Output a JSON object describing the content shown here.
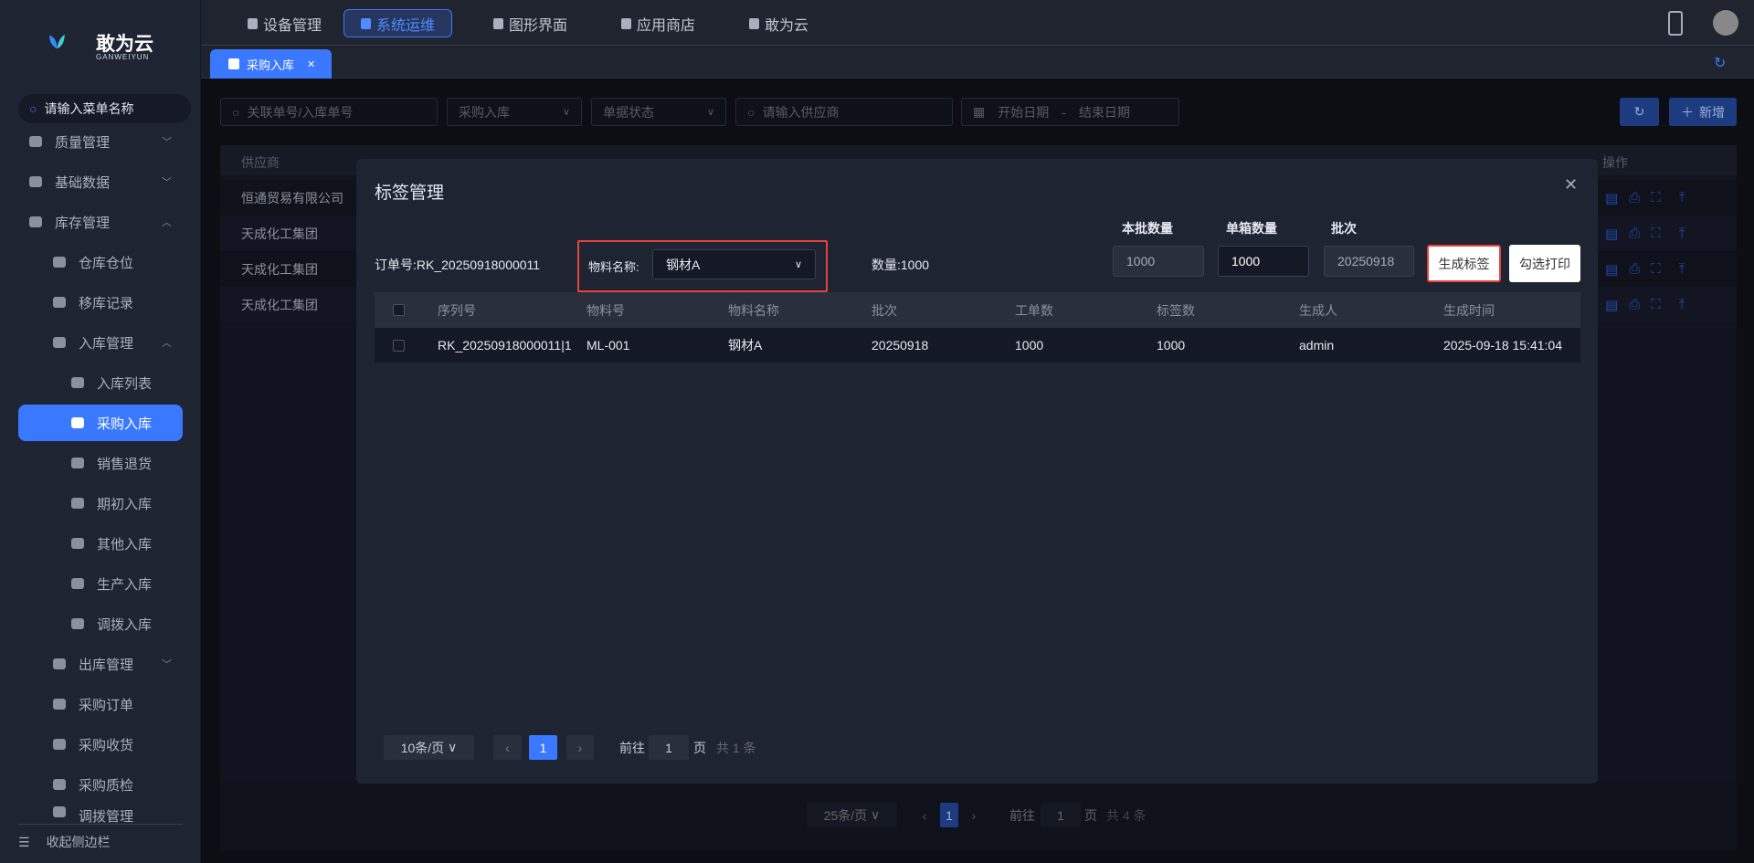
{
  "brand": {
    "name": "敢为云",
    "sub": "GANWEIYUN"
  },
  "sidebar": {
    "search_placeholder": "请输入菜单名称",
    "items": [
      {
        "label": "质量管理",
        "chev": "﹀"
      },
      {
        "label": "基础数据",
        "chev": "﹀"
      },
      {
        "label": "库存管理",
        "chev": "︿"
      },
      {
        "label": "仓库仓位"
      },
      {
        "label": "移库记录"
      },
      {
        "label": "入库管理",
        "chev": "︿"
      },
      {
        "label": "入库列表"
      },
      {
        "label": "采购入库"
      },
      {
        "label": "销售退货"
      },
      {
        "label": "期初入库"
      },
      {
        "label": "其他入库"
      },
      {
        "label": "生产入库"
      },
      {
        "label": "调拨入库"
      },
      {
        "label": "出库管理",
        "chev": "﹀"
      },
      {
        "label": "采购订单"
      },
      {
        "label": "采购收货"
      },
      {
        "label": "采购质检"
      },
      {
        "label": "调拨管理"
      }
    ],
    "collapse": "收起侧边栏"
  },
  "topnav": [
    "设备管理",
    "系统运维",
    "图形界面",
    "应用商店",
    "敢为云"
  ],
  "tab": {
    "label": "采购入库",
    "close": "✕"
  },
  "filters": {
    "search": "关联单号/入库单号",
    "type": "采购入库",
    "status": "单据状态",
    "supplier": "请输入供应商",
    "start": "开始日期",
    "sep": "-",
    "end": "结束日期",
    "add": "新增"
  },
  "table": {
    "headers": {
      "supplier": "供应商",
      "ops": "操作"
    },
    "rows": [
      "恒通贸易有限公司",
      "天成化工集团",
      "天成化工集团",
      "天成化工集团"
    ],
    "pagination": {
      "size": "25条/页",
      "page": "1",
      "goto": "前往",
      "goto_val": "1",
      "page_unit": "页",
      "total": "共 4 条"
    }
  },
  "modal": {
    "title": "标签管理",
    "close": "✕",
    "order": "订单号:RK_20250918000011",
    "material_label": "物料名称:",
    "material_value": "钢材A",
    "qty": "数量:1000",
    "batch_qty_label": "本批数量",
    "batch_qty": "1000",
    "box_qty_label": "单箱数量",
    "box_qty": "1000",
    "batch_label": "批次",
    "batch": "20250918",
    "generate": "生成标签",
    "print": "勾选打印",
    "headers": [
      "序列号",
      "物料号",
      "物料名称",
      "批次",
      "工单数",
      "标签数",
      "生成人",
      "生成时间"
    ],
    "rows": [
      [
        "RK_20250918000011|1",
        "ML-001",
        "钢材A",
        "20250918",
        "1000",
        "1000",
        "admin",
        "2025-09-18 15:41:04"
      ]
    ],
    "pagination": {
      "size": "10条/页",
      "page": "1",
      "goto": "前往",
      "goto_val": "1",
      "page_unit": "页",
      "total": "共 1 条"
    }
  }
}
